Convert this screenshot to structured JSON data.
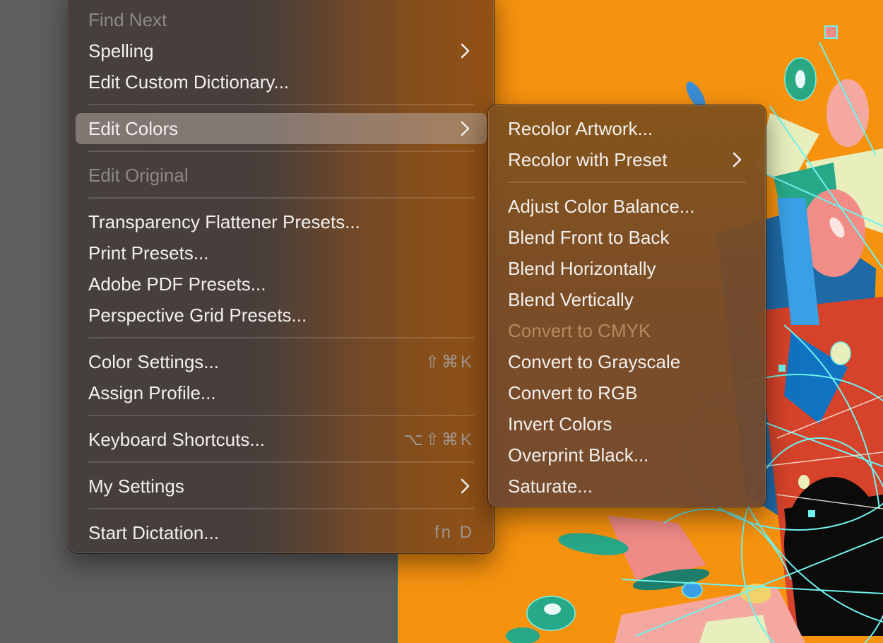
{
  "edit_menu": {
    "items": [
      {
        "label": "Find Next",
        "disabled": true
      },
      {
        "label": "Spelling",
        "submenu": true
      },
      {
        "label": "Edit Custom Dictionary..."
      },
      {
        "label": "Edit Colors",
        "submenu": true,
        "highlighted": true
      },
      {
        "label": "Edit Original",
        "disabled": true
      },
      {
        "label": "Transparency Flattener Presets..."
      },
      {
        "label": "Print Presets..."
      },
      {
        "label": "Adobe PDF Presets..."
      },
      {
        "label": "Perspective Grid Presets..."
      },
      {
        "label": "Color Settings...",
        "shortcut": "⇧⌘K"
      },
      {
        "label": "Assign Profile..."
      },
      {
        "label": "Keyboard Shortcuts...",
        "shortcut": "⌥⇧⌘K"
      },
      {
        "label": "My Settings",
        "submenu": true
      },
      {
        "label": "Start Dictation...",
        "shortcut": "fn D"
      }
    ]
  },
  "colors_submenu": {
    "items": [
      {
        "label": "Recolor Artwork..."
      },
      {
        "label": "Recolor with Preset",
        "submenu": true
      },
      {
        "label": "Adjust Color Balance..."
      },
      {
        "label": "Blend Front to Back"
      },
      {
        "label": "Blend Horizontally"
      },
      {
        "label": "Blend Vertically"
      },
      {
        "label": "Convert to CMYK",
        "disabled": true
      },
      {
        "label": "Convert to Grayscale"
      },
      {
        "label": "Convert to RGB"
      },
      {
        "label": "Invert Colors"
      },
      {
        "label": "Overprint Black..."
      },
      {
        "label": "Saturate..."
      }
    ]
  },
  "colors": {
    "workspace_bg": "#5e5e5e",
    "artboard_orange": "#f7920f",
    "highlight": "#9d918b",
    "text": "#f2efec",
    "disabled_text": "#8e8884",
    "selection_cyan": "#6ff3ee"
  }
}
